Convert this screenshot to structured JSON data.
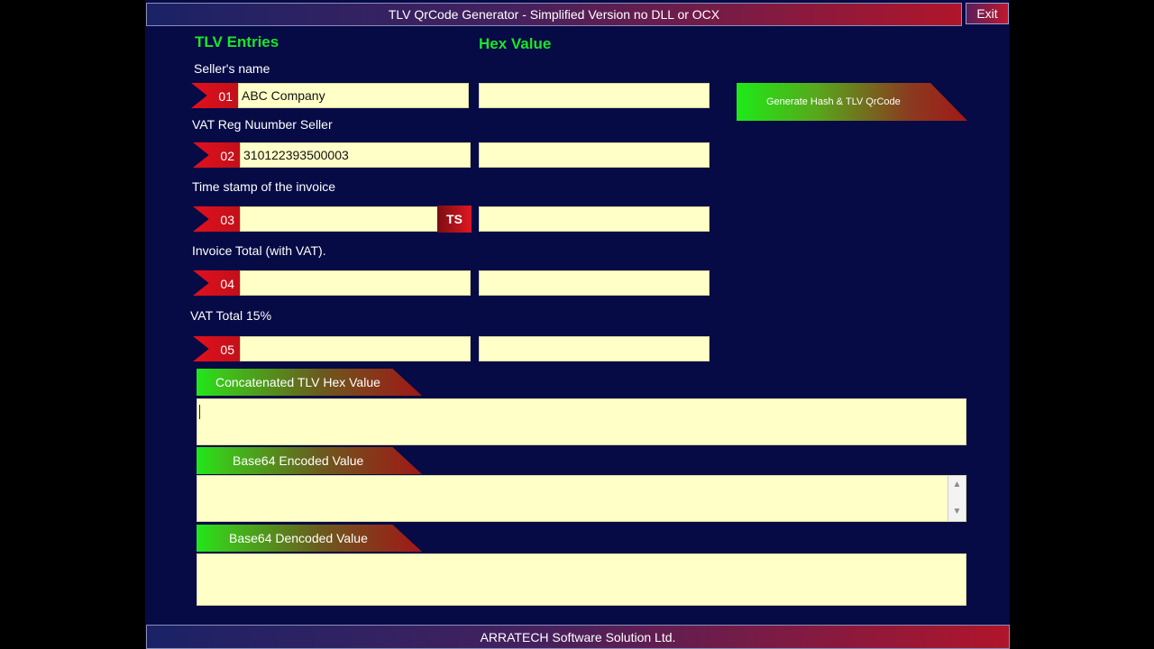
{
  "window": {
    "title": "TLV QrCode Generator - Simplified Version no DLL or OCX",
    "exit_label": "Exit"
  },
  "headings": {
    "entries": "TLV Entries",
    "hex": "Hex Value"
  },
  "rows": [
    {
      "label": "Seller's name",
      "tag": "01",
      "value": "ABC Company",
      "hex": ""
    },
    {
      "label": "VAT Reg Nuumber Seller",
      "tag": "02",
      "value": "310122393500003",
      "hex": ""
    },
    {
      "label": "Time stamp of the invoice",
      "tag": "03",
      "value": "",
      "hex": "",
      "button": "TS"
    },
    {
      "label": "Invoice Total (with VAT).",
      "tag": "04",
      "value": "",
      "hex": ""
    },
    {
      "label": "VAT Total 15%",
      "tag": "05",
      "value": "",
      "hex": ""
    }
  ],
  "generate_button": "Generate Hash & TLV QrCode",
  "sections": {
    "concatenated": {
      "label": "Concatenated TLV Hex Value",
      "value": ""
    },
    "base64_encoded": {
      "label": "Base64 Encoded Value",
      "value": ""
    },
    "base64_decoded": {
      "label": "Base64 Dencoded Value",
      "value": ""
    }
  },
  "footer": "ARRATECH Software Solution Ltd.",
  "colors": {
    "background": "#060a45",
    "heading": "#19e62a",
    "field": "#ffffc8",
    "tag": "#e2101c"
  },
  "icons": {
    "scroll_up": "chevron-up-icon",
    "scroll_down": "chevron-down-icon"
  }
}
